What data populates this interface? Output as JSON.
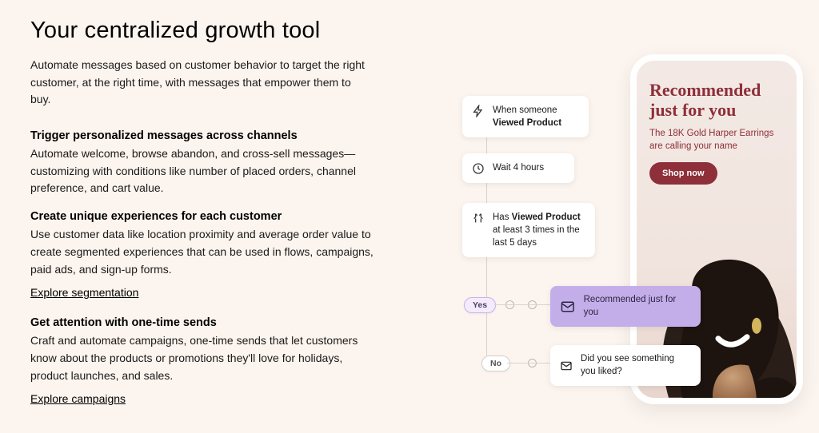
{
  "heading": "Your centralized growth tool",
  "lead": "Automate messages based on customer behavior to target the right customer, at the right time, with messages that empower them to buy.",
  "sections": [
    {
      "title": "Trigger personalized messages across channels",
      "body": "Automate welcome, browse abandon, and cross-sell messages—customizing with conditions like number of placed orders, channel preference, and cart value."
    },
    {
      "title": "Create unique experiences for each customer",
      "body": "Use customer data like location proximity and average order value to create segmented experiences that can be used in flows, campaigns, paid ads, and sign-up forms.",
      "link": "Explore segmentation"
    },
    {
      "title": "Get attention with one-time sends",
      "body": "Craft and automate campaigns, one-time sends that let customers know about the products or promotions they'll love for holidays, product launches, and sales.",
      "link": "Explore campaigns"
    }
  ],
  "flow": {
    "trigger_prefix": "When someone",
    "trigger_bold": "Viewed Product",
    "wait": "Wait 4 hours",
    "cond_prefix": "Has ",
    "cond_bold": "Viewed Product",
    "cond_suffix": " at least 3 times in the last 5 days",
    "yes": "Yes",
    "no": "No",
    "msg_yes": "Recommended just for you",
    "msg_no": "Did you see something you liked?"
  },
  "phone": {
    "title": "Recommended just for you",
    "subtitle": "The 18K Gold Harper Earrings are calling your name",
    "cta": "Shop now"
  }
}
